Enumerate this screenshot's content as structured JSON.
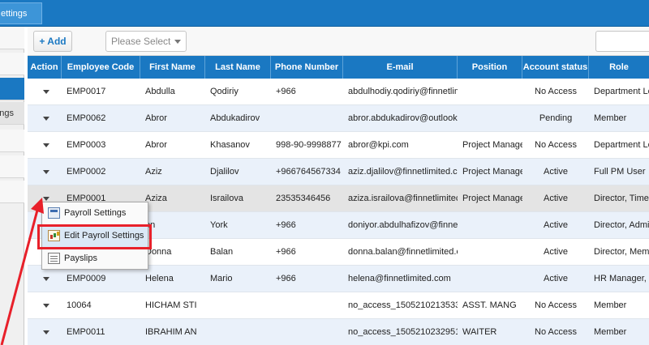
{
  "topbar": {
    "tab_label": "ettings"
  },
  "sidebar": {
    "partial_label": "ngs"
  },
  "toolbar": {
    "add_label": "+ Add",
    "select_placeholder": "Please Select"
  },
  "grid": {
    "headers": [
      "Action",
      "Employee Code",
      "First Name",
      "Last Name",
      "Phone Number",
      "E-mail",
      "Position",
      "Account status",
      "Role"
    ],
    "rows": [
      {
        "code": "EMP0017",
        "first": "Abdulla",
        "last": "Qodiriy",
        "phone": "+966",
        "email": "abdulhodiy.qodiriy@finnetlim",
        "position": "",
        "status": "No Access",
        "role": "Department Lea"
      },
      {
        "code": "EMP0062",
        "first": "Abror",
        "last": "Abdukadirov",
        "phone": "",
        "email": "abror.abdukadirov@outlook.",
        "position": "",
        "status": "Pending",
        "role": "Member"
      },
      {
        "code": "EMP0003",
        "first": "Abror",
        "last": "Khasanov",
        "phone": "998-90-9998877",
        "email": "abror@kpi.com",
        "position": "Project Manage",
        "status": "No Access",
        "role": "Department Lea"
      },
      {
        "code": "EMP0002",
        "first": "Aziz",
        "last": "Djalilov",
        "phone": "+966764567334",
        "email": "aziz.djalilov@finnetlimited.cc",
        "position": "Project Manage",
        "status": "Active",
        "role": "Full PM User"
      },
      {
        "code": "EMP0001",
        "first": "Aziza",
        "last": "Israilova",
        "phone": "23535346456",
        "email": "aziza.israilova@finnetlimitec",
        "position": "Project Manage",
        "status": "Active",
        "role": "Director, Times"
      },
      {
        "code": "",
        "first": "on",
        "last": "York",
        "phone": "+966",
        "email": "doniyor.abdulhafizov@finnet",
        "position": "",
        "status": "Active",
        "role": "Director, Admin"
      },
      {
        "code": "",
        "first": "Donna",
        "last": "Balan",
        "phone": "+966",
        "email": "donna.balan@finnetlimited.c",
        "position": "",
        "status": "Active",
        "role": "Director, Memb"
      },
      {
        "code": "EMP0009",
        "first": "Helena",
        "last": "Mario",
        "phone": "+966",
        "email": "helena@finnetlimited.com",
        "position": "",
        "status": "Active",
        "role": "HR Manager, M"
      },
      {
        "code": "10064",
        "first": "HICHAM STI",
        "last": "",
        "phone": "",
        "email": "no_access_1505210213533",
        "position": "ASST. MANG",
        "status": "No Access",
        "role": "Member"
      },
      {
        "code": "EMP0011",
        "first": "IBRAHIM AN",
        "last": "",
        "phone": "",
        "email": "no_access_1505210232951",
        "position": "WAITER",
        "status": "No Access",
        "role": "Member"
      }
    ]
  },
  "context_menu": {
    "items": [
      {
        "label": "Payroll Settings",
        "icon": "payroll-settings-icon"
      },
      {
        "label": "Edit Payroll Settings",
        "icon": "edit-payroll-icon"
      },
      {
        "label": "Payslips",
        "icon": "payslips-icon"
      }
    ]
  },
  "colors": {
    "accent": "#1a78c2",
    "annotation": "#e8202a",
    "row_alt": "#eaf1fa"
  }
}
